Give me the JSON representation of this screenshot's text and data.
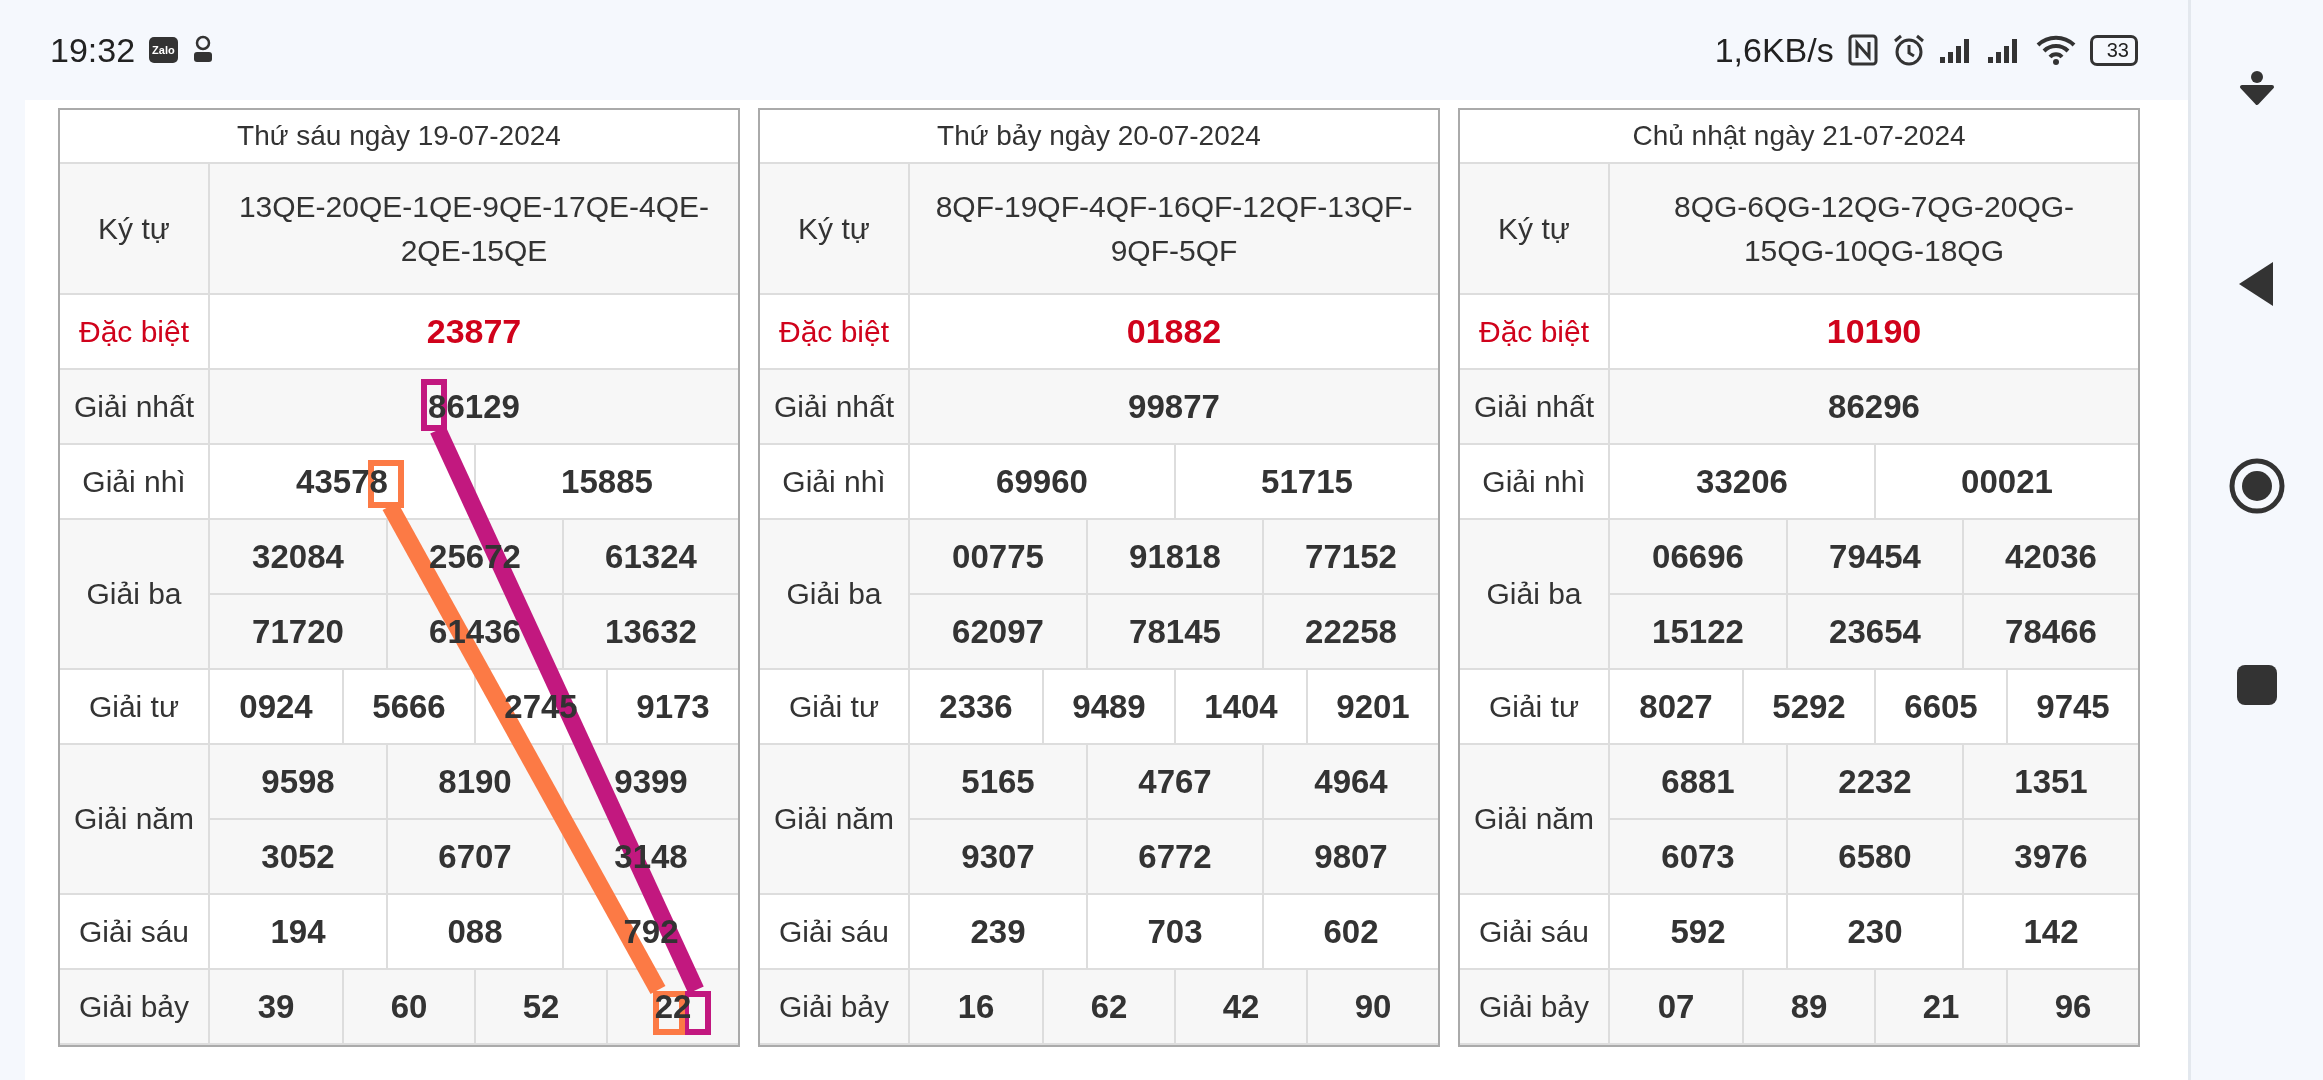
{
  "status_bar": {
    "time": "19:32",
    "app_badge": "Zalo",
    "net_speed": "1,6KB/s",
    "battery": "33"
  },
  "days": [
    {
      "title": "Thứ sáu ngày 19-07-2024",
      "code_label": "Ký tự",
      "code": "13QE-20QE-1QE-9QE-17QE-4QE-2QE-15QE",
      "prizes": [
        {
          "label": "Đặc biệt",
          "kind": "special",
          "rows": [
            [
              "23877"
            ]
          ]
        },
        {
          "label": "Giải nhất",
          "kind": "normal",
          "rows": [
            [
              "86129"
            ]
          ]
        },
        {
          "label": "Giải nhì",
          "kind": "normal",
          "rows": [
            [
              "43578",
              "15885"
            ]
          ]
        },
        {
          "label": "Giải ba",
          "kind": "normal",
          "rows": [
            [
              "32084",
              "25672",
              "61324"
            ],
            [
              "71720",
              "61436",
              "13632"
            ]
          ]
        },
        {
          "label": "Giải tư",
          "kind": "normal",
          "rows": [
            [
              "0924",
              "5666",
              "2745",
              "9173"
            ]
          ]
        },
        {
          "label": "Giải năm",
          "kind": "normal",
          "rows": [
            [
              "9598",
              "8190",
              "9399"
            ],
            [
              "3052",
              "6707",
              "3148"
            ]
          ]
        },
        {
          "label": "Giải sáu",
          "kind": "normal",
          "rows": [
            [
              "194",
              "088",
              "792"
            ]
          ]
        },
        {
          "label": "Giải bảy",
          "kind": "normal",
          "rows": [
            [
              "39",
              "60",
              "52",
              "22"
            ]
          ]
        }
      ],
      "annotated": true
    },
    {
      "title": "Thứ bảy ngày 20-07-2024",
      "code_label": "Ký tự",
      "code": "8QF-19QF-4QF-16QF-12QF-13QF-9QF-5QF",
      "prizes": [
        {
          "label": "Đặc biệt",
          "kind": "special",
          "rows": [
            [
              "01882"
            ]
          ]
        },
        {
          "label": "Giải nhất",
          "kind": "normal",
          "rows": [
            [
              "99877"
            ]
          ]
        },
        {
          "label": "Giải nhì",
          "kind": "normal",
          "rows": [
            [
              "69960",
              "51715"
            ]
          ]
        },
        {
          "label": "Giải ba",
          "kind": "normal",
          "rows": [
            [
              "00775",
              "91818",
              "77152"
            ],
            [
              "62097",
              "78145",
              "22258"
            ]
          ]
        },
        {
          "label": "Giải tư",
          "kind": "normal",
          "rows": [
            [
              "2336",
              "9489",
              "1404",
              "9201"
            ]
          ]
        },
        {
          "label": "Giải năm",
          "kind": "normal",
          "rows": [
            [
              "5165",
              "4767",
              "4964"
            ],
            [
              "9307",
              "6772",
              "9807"
            ]
          ]
        },
        {
          "label": "Giải sáu",
          "kind": "normal",
          "rows": [
            [
              "239",
              "703",
              "602"
            ]
          ]
        },
        {
          "label": "Giải bảy",
          "kind": "normal",
          "rows": [
            [
              "16",
              "62",
              "42",
              "90"
            ]
          ]
        }
      ],
      "annotated": false
    },
    {
      "title": "Chủ nhật ngày 21-07-2024",
      "code_label": "Ký tự",
      "code": "8QG-6QG-12QG-7QG-20QG-15QG-10QG-18QG",
      "prizes": [
        {
          "label": "Đặc biệt",
          "kind": "special",
          "rows": [
            [
              "10190"
            ]
          ]
        },
        {
          "label": "Giải nhất",
          "kind": "normal",
          "rows": [
            [
              "86296"
            ]
          ]
        },
        {
          "label": "Giải nhì",
          "kind": "normal",
          "rows": [
            [
              "33206",
              "00021"
            ]
          ]
        },
        {
          "label": "Giải ba",
          "kind": "normal",
          "rows": [
            [
              "06696",
              "79454",
              "42036"
            ],
            [
              "15122",
              "23654",
              "78466"
            ]
          ]
        },
        {
          "label": "Giải tư",
          "kind": "normal",
          "rows": [
            [
              "8027",
              "5292",
              "6605",
              "9745"
            ]
          ]
        },
        {
          "label": "Giải năm",
          "kind": "normal",
          "rows": [
            [
              "6881",
              "2232",
              "1351"
            ],
            [
              "6073",
              "6580",
              "3976"
            ]
          ]
        },
        {
          "label": "Giải sáu",
          "kind": "normal",
          "rows": [
            [
              "592",
              "230",
              "142"
            ]
          ]
        },
        {
          "label": "Giải bảy",
          "kind": "normal",
          "rows": [
            [
              "07",
              "89",
              "21",
              "96"
            ]
          ]
        }
      ],
      "annotated": false
    }
  ]
}
